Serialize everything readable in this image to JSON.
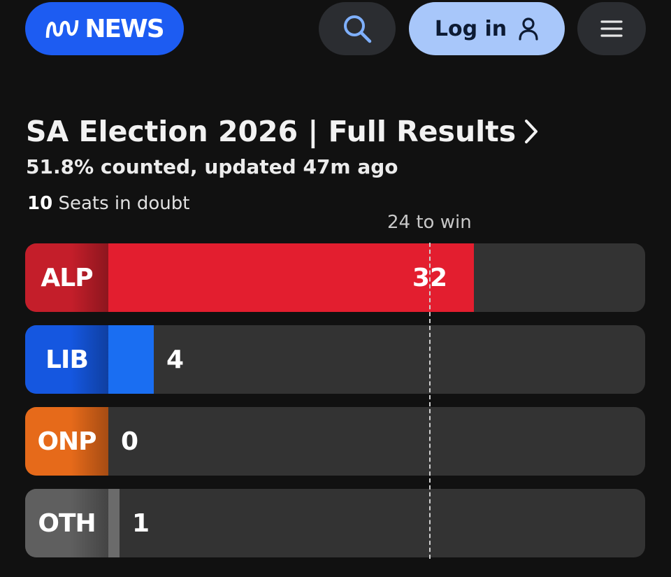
{
  "header": {
    "logo_text": "NEWS",
    "logo_mark": "abc-logo-mark",
    "search_icon": "search-icon",
    "login_label": "Log in",
    "login_icon": "user-icon",
    "menu_icon": "hamburger-menu-icon"
  },
  "results": {
    "title": "SA Election 2026 | Full Results",
    "title_icon": "chevron-right-icon",
    "counted_text": "51.8% counted, updated 47m ago",
    "seats_in_doubt_count": "10",
    "seats_in_doubt_label": " Seats in doubt",
    "to_win_label": "24 to win",
    "to_win_seats": 24,
    "max_seats": 47
  },
  "parties": [
    {
      "code": "ALP",
      "seats": 32,
      "label_color": "#c41e2a",
      "bar_color": "#e31e2f"
    },
    {
      "code": "LIB",
      "seats": 4,
      "label_color": "#1557e0",
      "bar_color": "#1a6ef2"
    },
    {
      "code": "ONP",
      "seats": 0,
      "label_color": "#e66a1a",
      "bar_color": "#e66a1a"
    },
    {
      "code": "OTH",
      "seats": 1,
      "label_color": "#5f5f5f",
      "bar_color": "#6b6b6b"
    }
  ],
  "colors": {
    "background": "#111111",
    "logo_background": "#1d5cf2",
    "login_background": "#a8c7fa",
    "icon_button_background": "#2b2d31",
    "bar_track": "#333333"
  }
}
